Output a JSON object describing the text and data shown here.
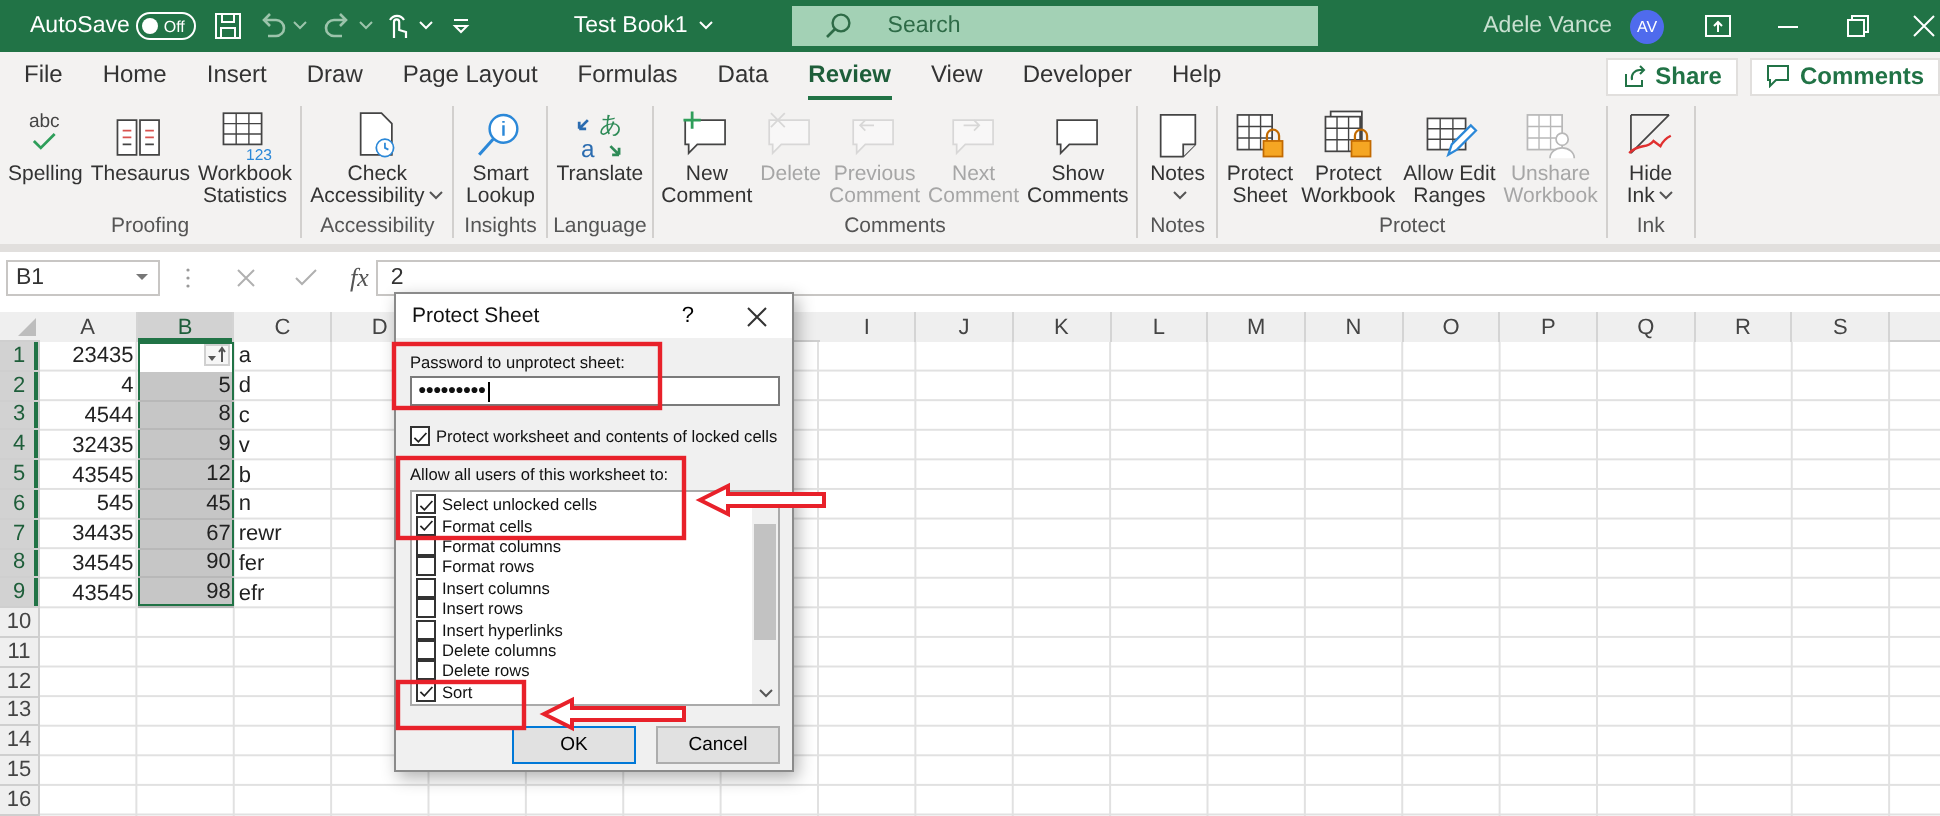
{
  "title_bar": {
    "autosave_label": "AutoSave",
    "autosave_state": "Off",
    "autosave_on": false,
    "document_title": "Test Book1",
    "search_placeholder": "Search",
    "user_name": "Adele Vance",
    "user_initials": "AV"
  },
  "menu_tabs": [
    {
      "label": "File",
      "selected": false
    },
    {
      "label": "Home",
      "selected": false
    },
    {
      "label": "Insert",
      "selected": false
    },
    {
      "label": "Draw",
      "selected": false
    },
    {
      "label": "Page Layout",
      "selected": false
    },
    {
      "label": "Formulas",
      "selected": false
    },
    {
      "label": "Data",
      "selected": false
    },
    {
      "label": "Review",
      "selected": true
    },
    {
      "label": "View",
      "selected": false
    },
    {
      "label": "Developer",
      "selected": false
    },
    {
      "label": "Help",
      "selected": false
    }
  ],
  "share_button": "Share",
  "comments_button": "Comments",
  "ribbon_groups": [
    {
      "label": "Proofing",
      "buttons": [
        {
          "label": [
            "Spelling"
          ],
          "icon_text": [
            "abc"
          ],
          "disabled": false,
          "dropdown": false
        },
        {
          "label": [
            "Thesaurus"
          ],
          "disabled": false,
          "dropdown": false
        },
        {
          "label": [
            "Workbook",
            "Statistics"
          ],
          "icon_text": [
            "123"
          ],
          "disabled": false,
          "dropdown": false
        }
      ]
    },
    {
      "label": "Accessibility",
      "buttons": [
        {
          "label": [
            "Check",
            "Accessibility"
          ],
          "disabled": false,
          "dropdown": true
        }
      ]
    },
    {
      "label": "Insights",
      "buttons": [
        {
          "label": [
            "Smart",
            "Lookup"
          ],
          "disabled": false,
          "dropdown": false
        }
      ]
    },
    {
      "label": "Language",
      "buttons": [
        {
          "label": [
            "Translate"
          ],
          "icon_text": [
            "あ",
            "a"
          ],
          "disabled": false,
          "dropdown": false
        }
      ]
    },
    {
      "label": "Comments",
      "buttons": [
        {
          "label": [
            "New",
            "Comment"
          ],
          "disabled": false,
          "dropdown": false
        },
        {
          "label": [
            "Delete"
          ],
          "disabled": true,
          "dropdown": false
        },
        {
          "label": [
            "Previous",
            "Comment"
          ],
          "disabled": true,
          "dropdown": false
        },
        {
          "label": [
            "Next",
            "Comment"
          ],
          "disabled": true,
          "dropdown": false
        },
        {
          "label": [
            "Show",
            "Comments"
          ],
          "disabled": false,
          "dropdown": false
        }
      ]
    },
    {
      "label": "Notes",
      "buttons": [
        {
          "label": [
            "Notes"
          ],
          "disabled": false,
          "dropdown": true
        }
      ]
    },
    {
      "label": "Protect",
      "buttons": [
        {
          "label": [
            "Protect",
            "Sheet"
          ],
          "disabled": false,
          "dropdown": false
        },
        {
          "label": [
            "Protect",
            "Workbook"
          ],
          "disabled": false,
          "dropdown": false
        },
        {
          "label": [
            "Allow Edit",
            "Ranges"
          ],
          "disabled": false,
          "dropdown": false
        },
        {
          "label": [
            "Unshare",
            "Workbook"
          ],
          "disabled": true,
          "dropdown": false
        }
      ]
    },
    {
      "label": "Ink",
      "buttons": [
        {
          "label": [
            "Hide",
            "Ink"
          ],
          "disabled": false,
          "dropdown": true
        }
      ]
    }
  ],
  "formula_bar": {
    "name_box": "B1",
    "function_button": "fx",
    "value": "2"
  },
  "sheet": {
    "columns": [
      {
        "label": "A",
        "selected": false
      },
      {
        "label": "B",
        "selected": true
      },
      {
        "label": "C",
        "selected": false
      },
      {
        "label": "D",
        "selected": false
      },
      {
        "label": "I",
        "selected": false
      },
      {
        "label": "J",
        "selected": false
      },
      {
        "label": "K",
        "selected": false
      },
      {
        "label": "L",
        "selected": false
      },
      {
        "label": "M",
        "selected": false
      },
      {
        "label": "N",
        "selected": false
      },
      {
        "label": "O",
        "selected": false
      },
      {
        "label": "P",
        "selected": false
      },
      {
        "label": "Q",
        "selected": false
      },
      {
        "label": "R",
        "selected": false
      },
      {
        "label": "S",
        "selected": false
      }
    ],
    "rows": [
      {
        "header": "1",
        "selected": true,
        "cells": [
          {
            "value": "23435",
            "kind": "number"
          },
          {
            "kind": "filter"
          },
          {
            "value": "a",
            "kind": "text"
          }
        ]
      },
      {
        "header": "2",
        "selected": true,
        "cells": [
          {
            "value": "4",
            "kind": "number"
          },
          {
            "value": "5",
            "kind": "number"
          },
          {
            "value": "d",
            "kind": "text"
          }
        ]
      },
      {
        "header": "3",
        "selected": true,
        "cells": [
          {
            "value": "4544",
            "kind": "number"
          },
          {
            "value": "8",
            "kind": "number"
          },
          {
            "value": "c",
            "kind": "text"
          }
        ]
      },
      {
        "header": "4",
        "selected": true,
        "cells": [
          {
            "value": "32435",
            "kind": "number"
          },
          {
            "value": "9",
            "kind": "number"
          },
          {
            "value": "v",
            "kind": "text"
          }
        ]
      },
      {
        "header": "5",
        "selected": true,
        "cells": [
          {
            "value": "43545",
            "kind": "number"
          },
          {
            "value": "12",
            "kind": "number"
          },
          {
            "value": "b",
            "kind": "text"
          }
        ]
      },
      {
        "header": "6",
        "selected": true,
        "cells": [
          {
            "value": "545",
            "kind": "number"
          },
          {
            "value": "45",
            "kind": "number"
          },
          {
            "value": "n",
            "kind": "text"
          }
        ]
      },
      {
        "header": "7",
        "selected": true,
        "cells": [
          {
            "value": "34435",
            "kind": "number"
          },
          {
            "value": "67",
            "kind": "number"
          },
          {
            "value": "rewr",
            "kind": "text"
          }
        ]
      },
      {
        "header": "8",
        "selected": true,
        "cells": [
          {
            "value": "34545",
            "kind": "number"
          },
          {
            "value": "90",
            "kind": "number"
          },
          {
            "value": "fer",
            "kind": "text"
          }
        ]
      },
      {
        "header": "9",
        "selected": true,
        "cells": [
          {
            "value": "43545",
            "kind": "number"
          },
          {
            "value": "98",
            "kind": "number"
          },
          {
            "value": "efr",
            "kind": "text"
          }
        ]
      },
      {
        "header": "10",
        "selected": false
      },
      {
        "header": "11",
        "selected": false
      },
      {
        "header": "12",
        "selected": false
      },
      {
        "header": "13",
        "selected": false
      },
      {
        "header": "14",
        "selected": false
      },
      {
        "header": "15",
        "selected": false
      },
      {
        "header": "16",
        "selected": false
      }
    ]
  },
  "dialog": {
    "title": "Protect Sheet",
    "help": "?",
    "password_label": "Password to unprotect sheet:",
    "password_value": "●●●●●●●●●",
    "protect_option": {
      "label": "Protect worksheet and contents of locked cells",
      "checked": true
    },
    "permissions_label": "Allow all users of this worksheet to:",
    "permissions": [
      {
        "label": "Select unlocked cells",
        "checked": true
      },
      {
        "label": "Format cells",
        "checked": true
      },
      {
        "label": "Format columns",
        "checked": false
      },
      {
        "label": "Format rows",
        "checked": false
      },
      {
        "label": "Insert columns",
        "checked": false
      },
      {
        "label": "Insert rows",
        "checked": false
      },
      {
        "label": "Insert hyperlinks",
        "checked": false
      },
      {
        "label": "Delete columns",
        "checked": false
      },
      {
        "label": "Delete rows",
        "checked": false
      },
      {
        "label": "Sort",
        "checked": true
      }
    ],
    "ok_button": "OK",
    "cancel_button": "Cancel"
  }
}
